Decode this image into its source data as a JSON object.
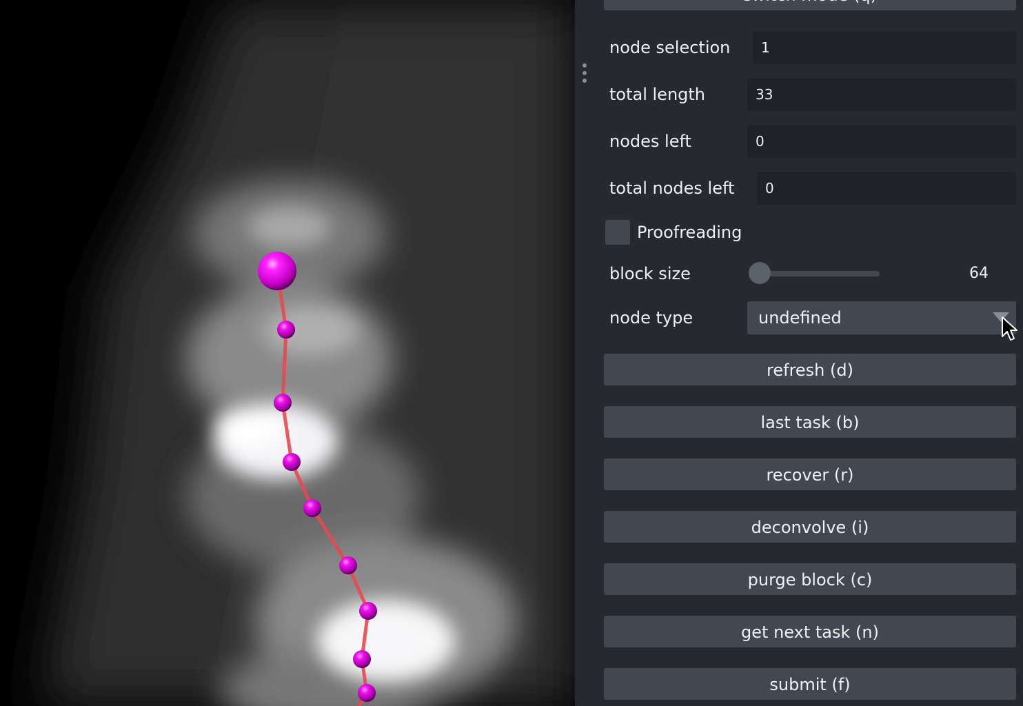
{
  "panel": {
    "switch_mode_label": "switch mode (q)",
    "fields": [
      {
        "label": "node selection",
        "value": "1"
      },
      {
        "label": "total length",
        "value": "33"
      },
      {
        "label": "nodes left",
        "value": "0"
      },
      {
        "label": "total nodes left",
        "value": "0"
      }
    ],
    "proofreading": {
      "label": "Proofreading",
      "checked": false
    },
    "block_size": {
      "label": "block size",
      "value": "64"
    },
    "node_type": {
      "label": "node type",
      "selected": "undefined"
    },
    "buttons": [
      "refresh (d)",
      "last task (b)",
      "recover (r)",
      "deconvolve (i)",
      "purge block (c)",
      "get next task (n)",
      "submit (f)"
    ]
  },
  "colors": {
    "panel_bg": "#262930",
    "button_bg": "#414851",
    "node_color": "#e600e6",
    "edge_color": "#e8484f"
  },
  "icons": {
    "handle": "drag-handle-icon",
    "dropdown": "chevron-down-icon",
    "cursor": "mouse-pointer-icon"
  }
}
